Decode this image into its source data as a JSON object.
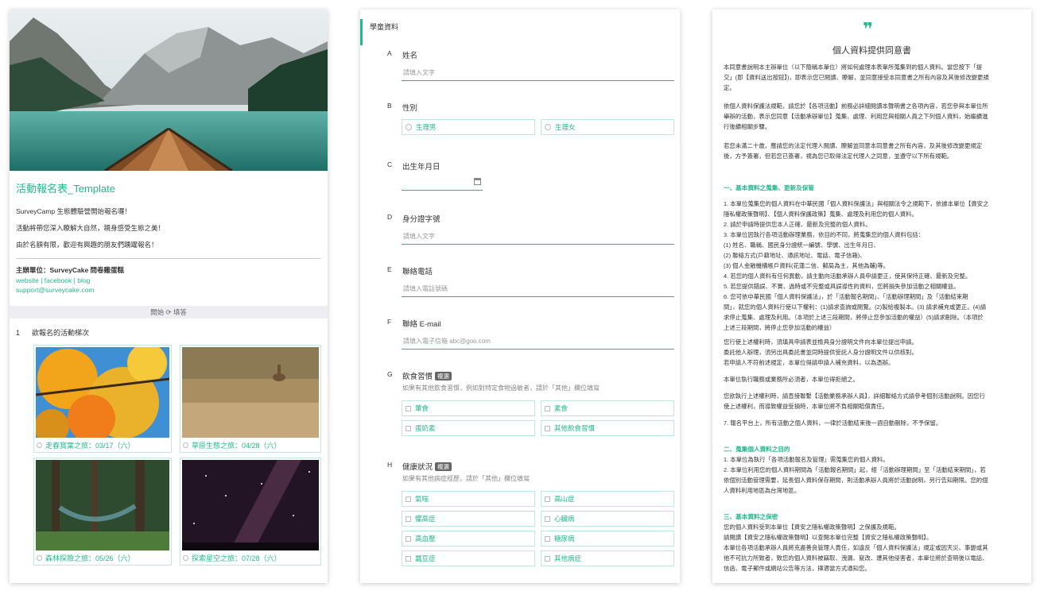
{
  "form": {
    "title": "活動報名表_Template",
    "intro": [
      "SurveyCamp 生態體驗營開始報名囉！",
      "活動將帶您深入瞭解大自然，親身感受生態之美！",
      "由於名額有限，歡迎有興趣的朋友們踴躍報名！"
    ],
    "organizer": "主辦單位：SurveyCake 問卷雞蛋糕",
    "links": [
      "website",
      "facebook",
      "blog"
    ],
    "email": "support@surveycake.com",
    "start_label": "開始 ⟳ 填答",
    "q1": {
      "number": "1",
      "title": "欲報名的活動梯次",
      "options": [
        "走春賞葉之旅：03/17（六）",
        "草原生態之旅：04/28（六）",
        "森林探險之旅：05/26（六）",
        "探索星空之旅：07/28（六）"
      ]
    }
  },
  "student": {
    "section_title": "學童資料",
    "name": {
      "letter": "A",
      "label": "姓名",
      "placeholder": "請填入文字"
    },
    "gender": {
      "letter": "B",
      "label": "性別",
      "options": [
        "生理男",
        "生理女"
      ]
    },
    "birthday": {
      "letter": "C",
      "label": "出生年月日"
    },
    "id_number": {
      "letter": "D",
      "label": "身分證字號",
      "placeholder": "請填入文字"
    },
    "phone": {
      "letter": "E",
      "label": "聯絡電話",
      "placeholder": "請填入電話號碼"
    },
    "email": {
      "letter": "F",
      "label": "聯絡 E-mail",
      "placeholder": "請填入電子信箱 abc@goo.com"
    },
    "diet": {
      "letter": "G",
      "label": "飲食習慣",
      "tag": "複選",
      "hint": "如果有其他飲食習慣，例如對特定食物過敏者，請於「其他」欄位填寫",
      "options": [
        "葷食",
        "素食",
        "蛋奶素",
        "其他飲食習慣"
      ]
    },
    "health": {
      "letter": "H",
      "label": "健康狀況",
      "tag": "複選",
      "hint": "如果有其他病症經歷，請於「其他」欄位填寫",
      "options": [
        "氣喘",
        "高山症",
        "懼高症",
        "心臟病",
        "高血壓",
        "糖尿病",
        "蠶豆症",
        "其他病症"
      ]
    }
  },
  "consent": {
    "title": "個人資料提供同意書",
    "quote_mark": "❞",
    "p1": "本同意書說明本主辦單位（以下簡稱本單位）將如何處理本表單所蒐集到的個人資料。當您按下「提\n交」(即【資料送出按鈕】)，即表示您已閱讀、瞭解，並同意接受本同意書之所有內容及其後修改變更規\n定。",
    "p2": "依個人資料保護法規範，請您於【各項活動】前務必詳細閱讀本聲明書之各項內容，若您參與本單位所\n舉辦的活動，表示您同意【活動承辦單位】蒐集、處理、利用您與相關人員之下列個人資料，始繼續進\n行後續相關步驟。",
    "p3": "若您未滿二十歲，應請您的法定代理人閱讀、瞭解並同意本同意書之所有內容，及其後修改變更規定\n後，方予簽署，但若您已簽署，視為您已取得法定代理人之同意，並遵守以下所有規範。",
    "h1": "一、基本資料之蒐集、更新及保管",
    "s1": "1. 本單位蒐集您的個人資料在中華民國「個人資料保護法」與相關法令之規範下，依據本單位【資安之\n隱私權政策聲明】、【個人資料保護政策】蒐集、處理及利用您的個人資料。\n2. 請於申請時提供您本人正確、最新及完整的個人資料。\n3. 本單位因執行各項活動辦理業務，依目的不同，將蒐集您的個人資料包括：\n   (1) 姓名、職稱、國民身分證統一編號、學號、出生年月日、\n   (2) 聯絡方式(戶籍地址、通訊地址、電話、電子信箱)、\n   (3) 個人金融機構帳戶資料(花蓮二信、郵局為主，其他為輔)等。\n4. 若您的個人資料有任何異動，請主動向活動承辦人員申請更正，使其保持正確、最新及完整。\n5. 若您提供錯誤、不實、過時或不完整或具誤導性的資料，您將損失參加活動之相關權益。\n6. 您可依中華民國「個人資料保護法」，於「活動報名期間」、「活動辦理期間」及「活動結束期\n間」，就您的個人資料行使以下權利：(1)請求查詢或閱覽。(2)製給複製本。(3) 請求補充或更正。(4)請\n求停止蒐集、處理及利用。（本項於上述三段期間，將停止您參加活動的權益）(5)請求刪除。（本項於\n上述三段期間，將停止您參加活動的權益）",
    "s1b": "您行使上述權利時，須填具申請表並檢具身分證明文件向本單位提出申請。\n委託他人辦理，須另出具委託書並同時提供受託人身分證明文件以供核對。\n若申請人不符前述規定，本單位得請申請人補充資料，以為憑辦。",
    "s1c": "本單位執行職務或業務所必須者，本單位得拒絕之。",
    "s1d": "您欲執行上述權利時，請直接聯繫【活動業務承辦人員】，詳細聯絡方式請參考個別活動說明。因您行\n使上述權利，而導致權益受損時，本單位將不負相關賠償責任。",
    "s1e": "7. 報名平台上，所有活動之個人資料，一律於活動結束後一週自動刪除，不予保留。",
    "h2": "二、蒐集個人資料之目的",
    "s2": "1. 本單位為執行「各項活動報名及管理」需蒐集您的個人資料。\n2. 本單位利用您的個人資料期間為「活動報名期間」起，經「活動辦理期間」至「活動結束期間」，若\n依個別活動管理需要，延長個人資料保存期間，則活動承辦人員將於活動說明，另行告知期限。您的個\n人資料利用地區為台灣地區。",
    "h3": "三、基本資料之保密",
    "s3": "您的個人資料受到本單位【資安之隱私權政策聲明】之保護及規範。\n請閱讀【資安之隱私權政策聲明】以查閱本單位完整【資安之隱私權政策聲明】。\n本單位各項活動承辦人員將克盡善良管理人責任，如違反「個人資料保護法」規定或因天災、事變或其\n他不可抗力所致者，致您的個人資料被竊取、洩漏、竄改、遭其他侵害者，本單位將於查明後以電話、\n信函、電子郵件或網站公告等方法，擇適當方式通知您。"
  },
  "colors": {
    "accent": "#21b98d",
    "option_border": "#bfe9dc"
  }
}
